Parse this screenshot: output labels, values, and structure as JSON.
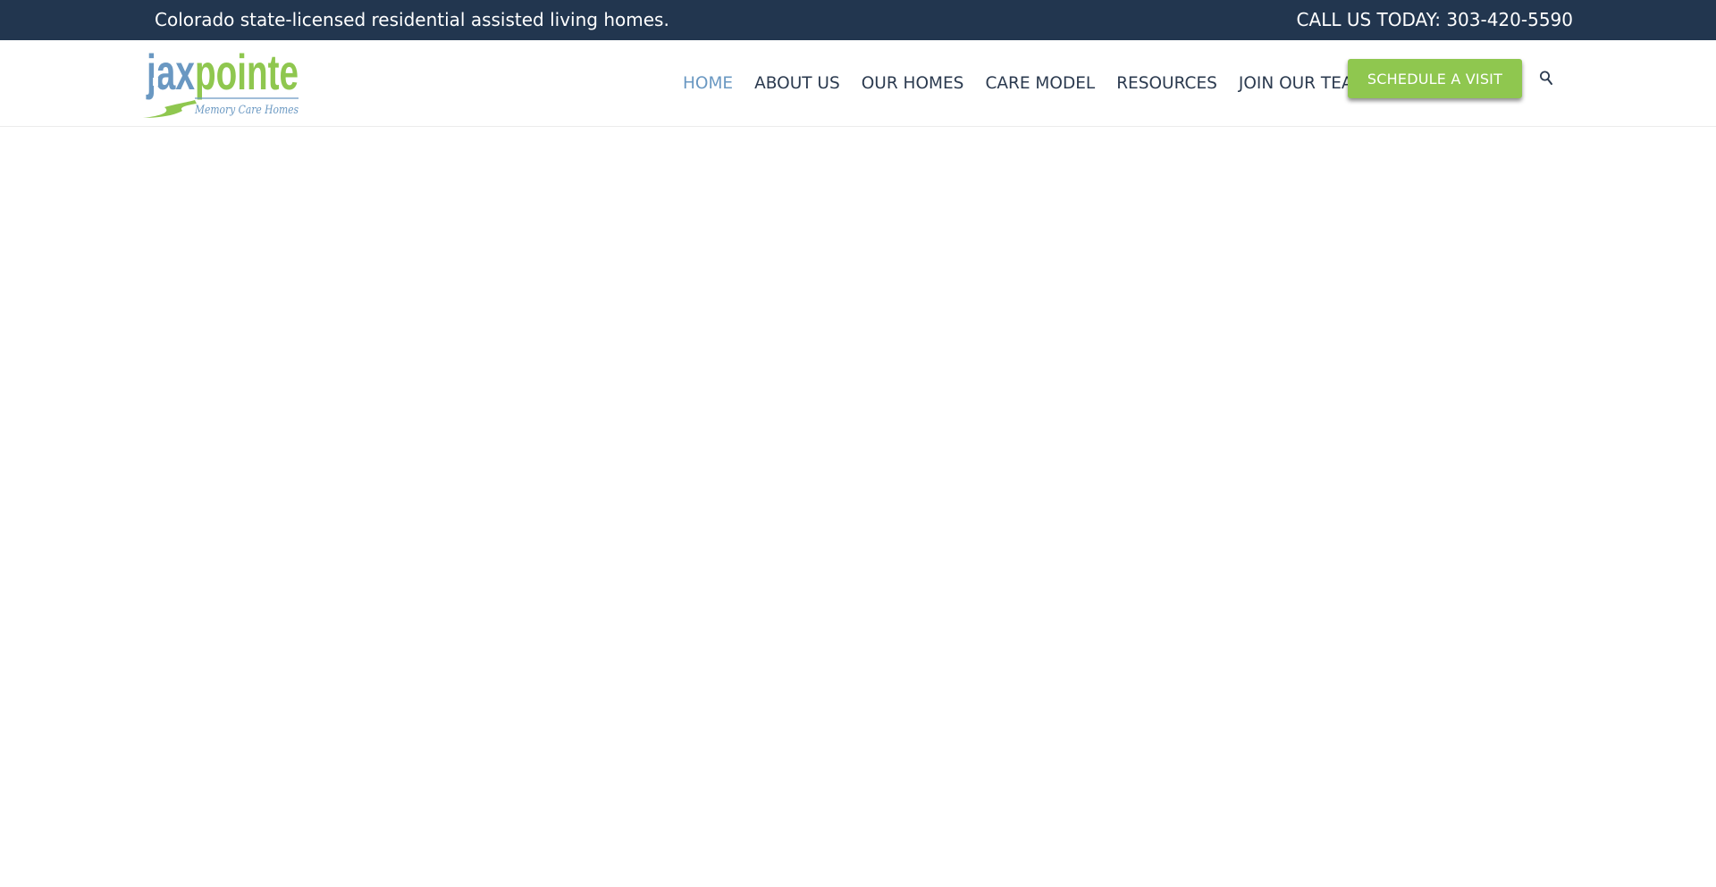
{
  "topbar": {
    "tagline": "Colorado state-licensed residential assisted living homes.",
    "phone": "CALL US TODAY: 303-420-5590"
  },
  "brand": {
    "logo_main_left": "jax",
    "logo_main_right": "pointe",
    "logo_sub": "Memory Care Homes",
    "colors": {
      "blue": "#6a98c2",
      "green": "#8fc74f",
      "navy": "#22364f"
    }
  },
  "nav": {
    "items": [
      {
        "label": "HOME",
        "active": true
      },
      {
        "label": "ABOUT US",
        "active": false
      },
      {
        "label": "OUR HOMES",
        "active": false
      },
      {
        "label": "CARE MODEL",
        "active": false
      },
      {
        "label": "RESOURCES",
        "active": false
      },
      {
        "label": "JOIN OUR TEAM",
        "active": false
      }
    ],
    "cta_label": "SCHEDULE A VISIT",
    "search_icon": "search-icon"
  }
}
